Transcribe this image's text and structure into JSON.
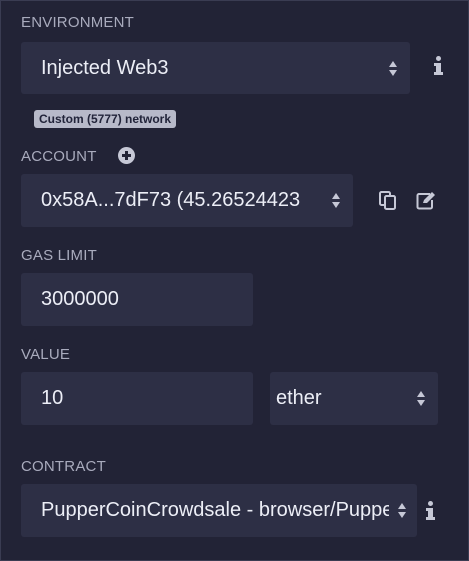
{
  "environment": {
    "label": "ENVIRONMENT",
    "selected": "Injected Web3",
    "network_badge": "Custom (5777) network"
  },
  "account": {
    "label": "ACCOUNT",
    "selected": "0x58A...7dF73 (45.26524423"
  },
  "gas_limit": {
    "label": "GAS LIMIT",
    "value": "3000000"
  },
  "value": {
    "label": "VALUE",
    "amount": "10",
    "unit": "ether"
  },
  "contract": {
    "label": "CONTRACT",
    "selected": "PupperCoinCrowdsale - browser/PupperCoinCrowdsale.sol"
  },
  "colors": {
    "background": "#222336",
    "field": "#2d2f45",
    "text": "#eceef6",
    "label": "#a9abbd"
  }
}
